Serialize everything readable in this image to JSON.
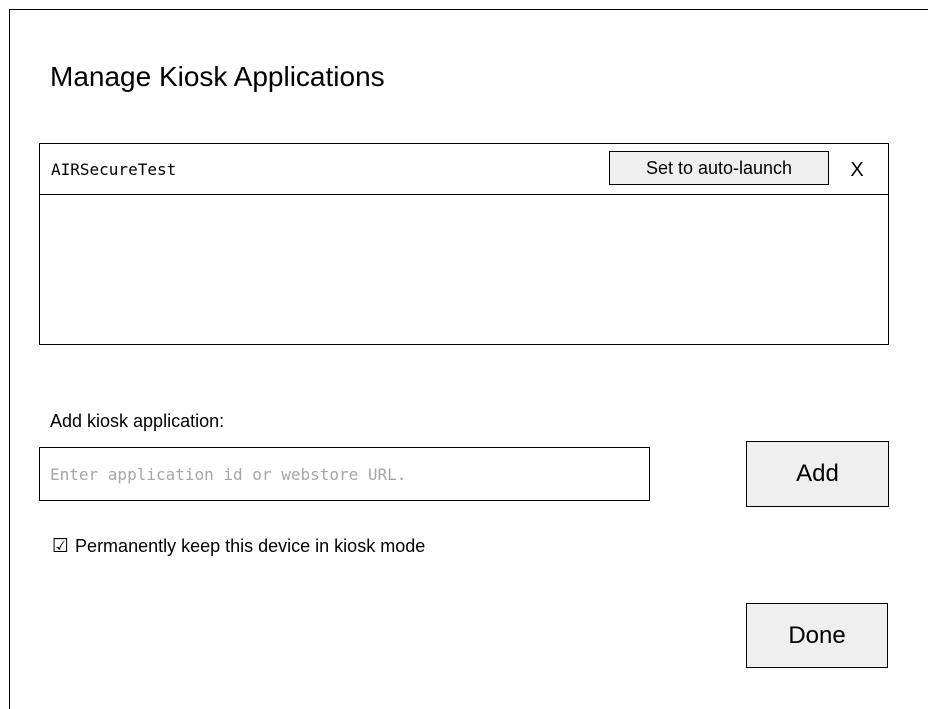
{
  "dialog": {
    "title": "Manage Kiosk Applications"
  },
  "apps": [
    {
      "name": "AIRSecureTest",
      "auto_launch_label": "Set to auto-launch",
      "remove_label": "X"
    }
  ],
  "add_section": {
    "label": "Add kiosk application:",
    "input_value": "",
    "input_placeholder": "Enter application id or webstore URL.",
    "add_button_label": "Add"
  },
  "keep_kiosk": {
    "checked": true,
    "checkbox_glyph": "☑",
    "label": "Permanently keep this device in kiosk mode"
  },
  "footer": {
    "done_button_label": "Done"
  }
}
